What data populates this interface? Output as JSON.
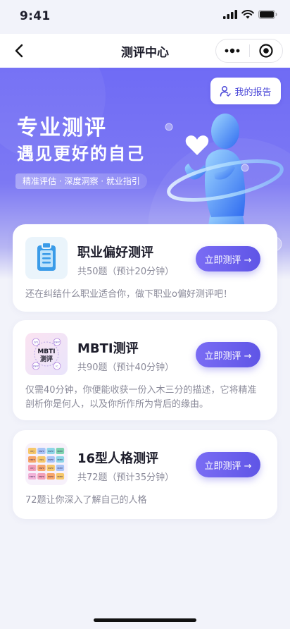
{
  "status": {
    "time": "9:41"
  },
  "nav": {
    "title": "测评中心"
  },
  "banner": {
    "title1": "专业测评",
    "title2": "遇见更好的自己",
    "tag": "精准评估 · 深度洞察 · 就业指引",
    "report_label": "我的报告"
  },
  "cards": [
    {
      "title": "职业偏好测评",
      "sub": "共50题（预计20分钟）",
      "button": "立即测评 →",
      "desc": "还在纠结什么职业适合你，做下职业o偏好测评吧！",
      "icon": "clipboard-icon"
    },
    {
      "title": "MBTI测评",
      "sub": "共90题（预计40分钟）",
      "button": "立即测评 →",
      "desc": "仅需40分钟，你便能收获一份入木三分的描述，它将精准剖析你是何人，以及你所作所为背后的缘由。",
      "icon": "mbti-icon"
    },
    {
      "title": "16型人格测评",
      "sub": "共72题（预计35分钟）",
      "button": "立即测评 →",
      "desc": "72题让你深入了解自己的人格",
      "icon": "personality-grid-icon"
    }
  ],
  "mbti_icon": {
    "label1": "MBTI",
    "label2": "测评",
    "nodes": [
      "ISTJ",
      "ENFP",
      "ENFP",
      "IC"
    ]
  },
  "grid_icon": {
    "cells": [
      "ISTJ",
      "ENFP",
      "ENFP",
      "ENFP",
      "ENFP",
      "ISFJ",
      "ENFP",
      "ENFP",
      "ISTJ",
      "ENFP",
      "ENFP",
      "ENFP",
      "ENFP",
      "ENFP",
      "ENFP",
      "ENFP"
    ]
  },
  "colors": {
    "accent": "#5f55e6",
    "banner": "#6f6bf5",
    "background": "#f2f3fa"
  }
}
